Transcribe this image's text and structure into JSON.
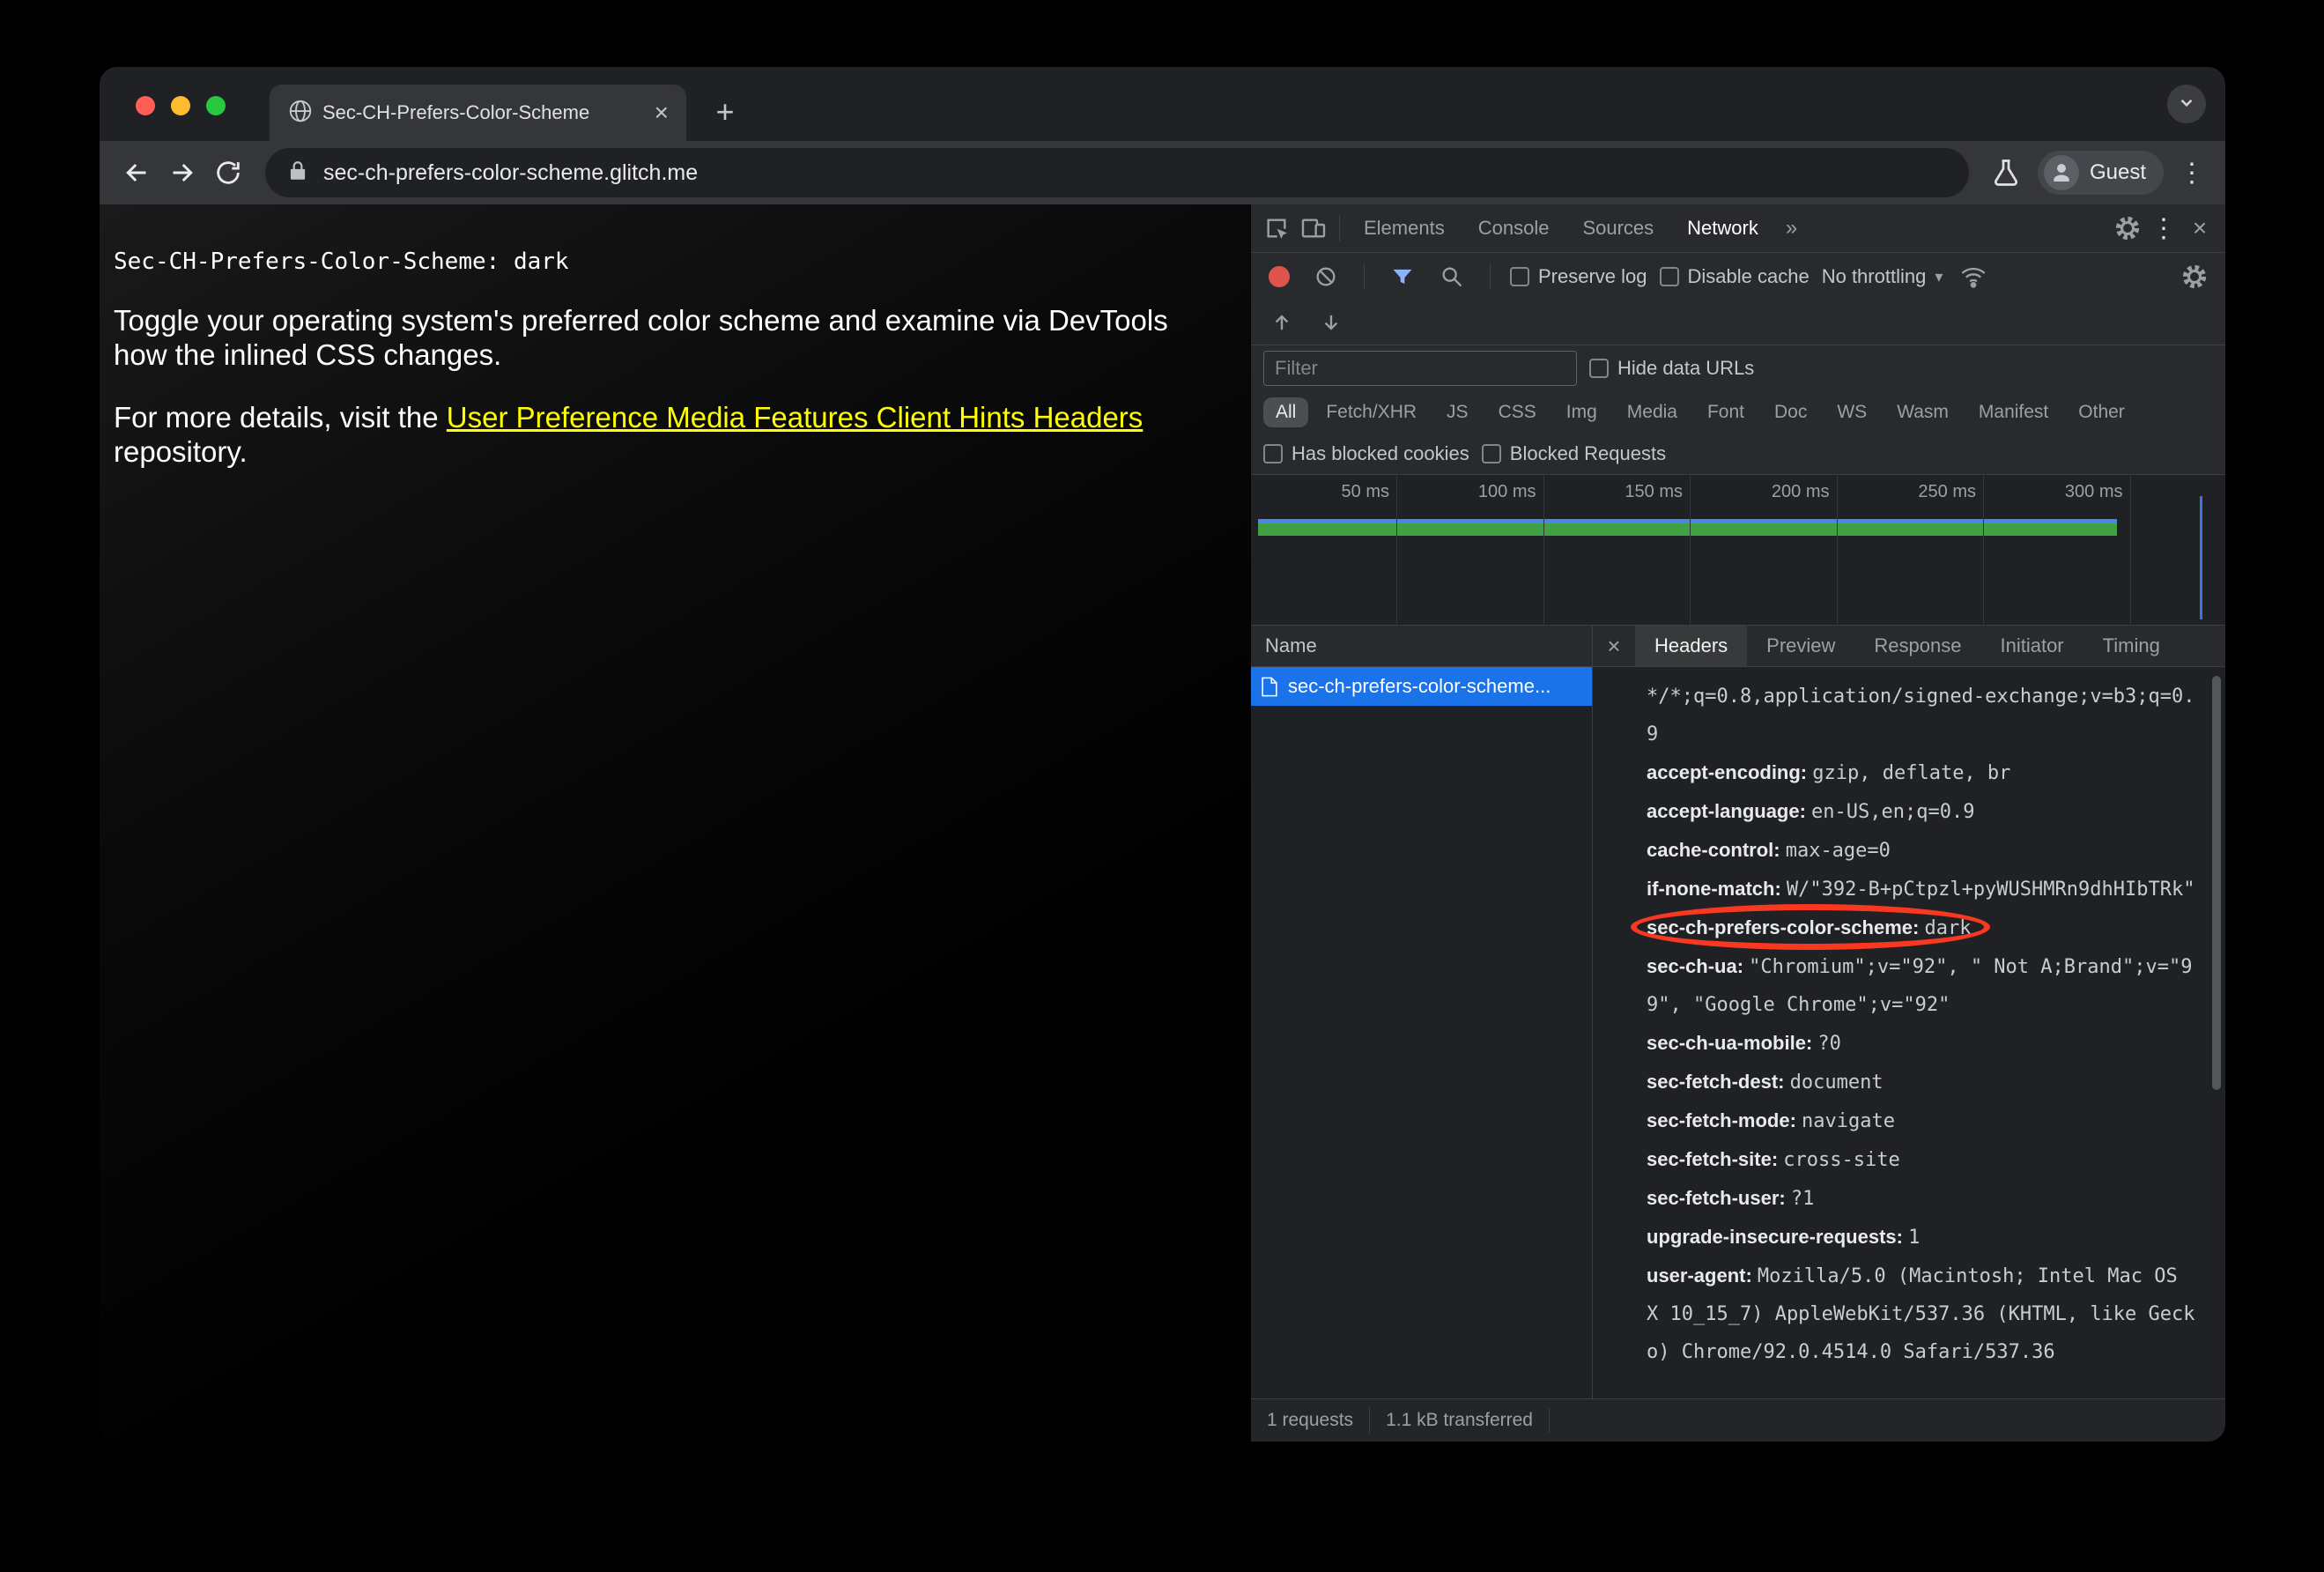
{
  "browser": {
    "tab_title": "Sec-CH-Prefers-Color-Scheme",
    "url": "sec-ch-prefers-color-scheme.glitch.me",
    "profile_label": "Guest"
  },
  "icons": {
    "close": "×",
    "new_tab": "+",
    "kebab": "⋮",
    "more_tabs": "»",
    "caret_down": "▾"
  },
  "page": {
    "header_line": "Sec-CH-Prefers-Color-Scheme: dark",
    "paragraph1": "Toggle your operating system's preferred color scheme and examine via DevTools how the inlined CSS changes.",
    "paragraph2_prefix": "For more details, visit the ",
    "paragraph2_link": "User Preference Media Features Client Hints Headers",
    "paragraph2_suffix": " repository.",
    "link_color": "#ffff00"
  },
  "devtools": {
    "panel_tabs": [
      "Elements",
      "Console",
      "Sources",
      "Network"
    ],
    "selected_panel_tab": "Network",
    "network_toolbar": {
      "preserve_log": "Preserve log",
      "disable_cache": "Disable cache",
      "throttling": "No throttling"
    },
    "filter_bar": {
      "placeholder": "Filter",
      "hide_data_urls": "Hide data URLs",
      "chips": [
        "All",
        "Fetch/XHR",
        "JS",
        "CSS",
        "Img",
        "Media",
        "Font",
        "Doc",
        "WS",
        "Wasm",
        "Manifest",
        "Other"
      ],
      "selected_chip": "All",
      "has_blocked_cookies": "Has blocked cookies",
      "blocked_requests": "Blocked Requests"
    },
    "timeline": {
      "ticks": [
        "50 ms",
        "100 ms",
        "150 ms",
        "200 ms",
        "250 ms",
        "300 ms"
      ]
    },
    "requests_table": {
      "name_column": "Name",
      "rows": [
        {
          "name": "sec-ch-prefers-color-scheme...",
          "selected": true
        }
      ]
    },
    "details_tabs": [
      "Headers",
      "Preview",
      "Response",
      "Initiator",
      "Timing"
    ],
    "selected_details_tab": "Headers",
    "request_headers": [
      {
        "key": "",
        "value": "*/*;q=0.8,application/signed-exchange;v=b3;q=0.9"
      },
      {
        "key": "accept-encoding",
        "value": "gzip, deflate, br"
      },
      {
        "key": "accept-language",
        "value": "en-US,en;q=0.9"
      },
      {
        "key": "cache-control",
        "value": "max-age=0"
      },
      {
        "key": "if-none-match",
        "value": "W/\"392-B+pCtpzl+pyWUSHMRn9dhHIbTRk\""
      },
      {
        "key": "sec-ch-prefers-color-scheme",
        "value": "dark",
        "circled": true
      },
      {
        "key": "sec-ch-ua",
        "value": "\"Chromium\";v=\"92\", \" Not A;Brand\";v=\"99\", \"Google Chrome\";v=\"92\""
      },
      {
        "key": "sec-ch-ua-mobile",
        "value": "?0"
      },
      {
        "key": "sec-fetch-dest",
        "value": "document"
      },
      {
        "key": "sec-fetch-mode",
        "value": "navigate"
      },
      {
        "key": "sec-fetch-site",
        "value": "cross-site"
      },
      {
        "key": "sec-fetch-user",
        "value": "?1"
      },
      {
        "key": "upgrade-insecure-requests",
        "value": "1"
      },
      {
        "key": "user-agent",
        "value": "Mozilla/5.0 (Macintosh; Intel Mac OS X 10_15_7) AppleWebKit/537.36 (KHTML, like Gecko) Chrome/92.0.4514.0 Safari/537.36"
      }
    ],
    "status_bar": {
      "requests": "1 requests",
      "transferred": "1.1 kB transferred"
    },
    "accent_colors": {
      "selected_row": "#1a73e8",
      "annotation": "#f93822",
      "record": "#e0544e",
      "filter_active": "#8ab4f8"
    }
  }
}
